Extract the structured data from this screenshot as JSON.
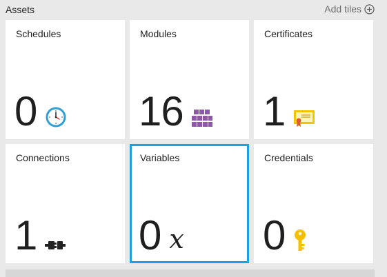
{
  "header": {
    "title": "Assets",
    "add_tiles_label": "Add tiles"
  },
  "tiles": [
    {
      "label": "Schedules",
      "count": "0",
      "icon": "clock-icon"
    },
    {
      "label": "Modules",
      "count": "16",
      "icon": "modules-grid-icon"
    },
    {
      "label": "Certificates",
      "count": "1",
      "icon": "certificate-icon"
    },
    {
      "label": "Connections",
      "count": "1",
      "icon": "plug-connector-icon"
    },
    {
      "label": "Variables",
      "count": "0",
      "icon": "variable-x-icon",
      "icon_text": "x",
      "selected": true
    },
    {
      "label": "Credentials",
      "count": "0",
      "icon": "key-icon"
    }
  ],
  "colors": {
    "selected_border": "#1ba1e2",
    "modules_icon": "#8e5aa8",
    "certificate_icon": "#f3c400",
    "key_icon": "#f5c000",
    "clock_icon": "#2f9fd8"
  }
}
